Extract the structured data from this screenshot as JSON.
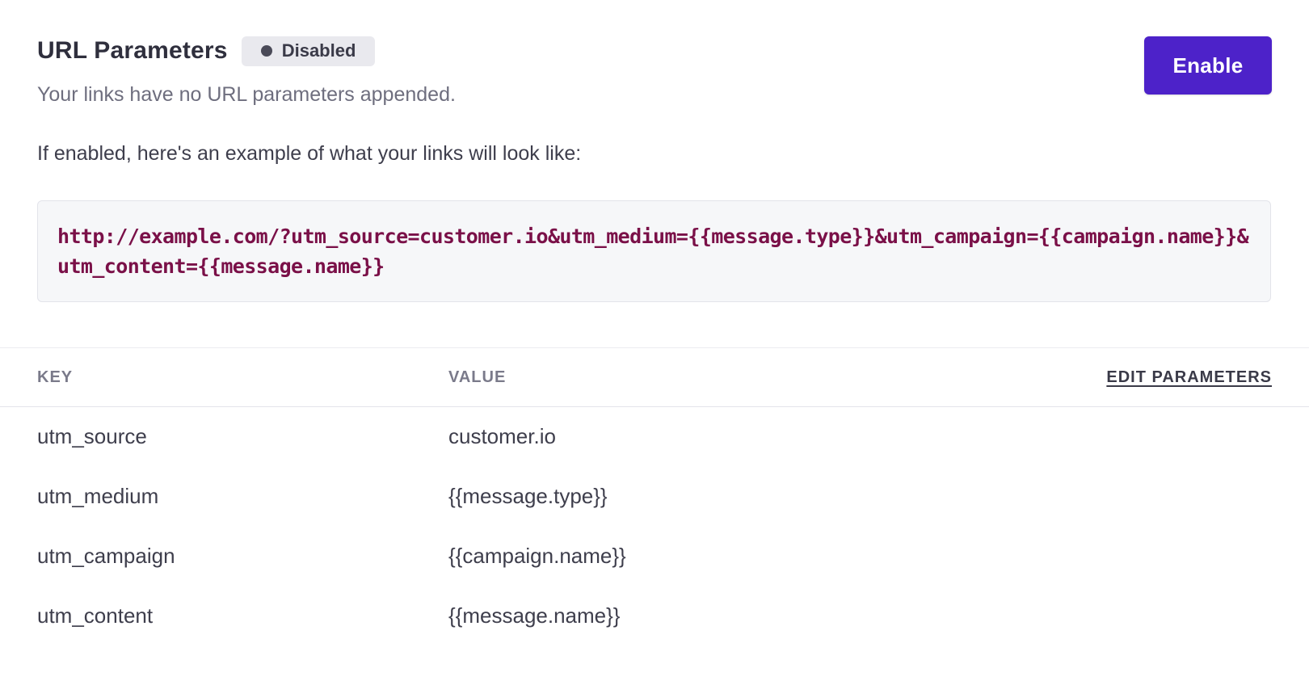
{
  "header": {
    "title": "URL Parameters",
    "status_badge": "Disabled",
    "subtitle": "Your links have no URL parameters appended.",
    "enable_label": "Enable"
  },
  "example": {
    "intro": "If enabled, here's an example of what your links will look like:",
    "url": "http://example.com/?utm_source=customer.io&utm_medium={{message.type}}&utm_campaign={{campaign.name}}&utm_content={{message.name}}"
  },
  "table": {
    "columns": {
      "key": "KEY",
      "value": "VALUE",
      "edit": "EDIT PARAMETERS"
    },
    "rows": [
      {
        "key": "utm_source",
        "value": "customer.io"
      },
      {
        "key": "utm_medium",
        "value": "{{message.type}}"
      },
      {
        "key": "utm_campaign",
        "value": "{{campaign.name}}"
      },
      {
        "key": "utm_content",
        "value": "{{message.name}}"
      }
    ]
  },
  "colors": {
    "accent": "#4d22c9",
    "code": "#7a1048",
    "badge_bg": "#e9e9ee"
  }
}
